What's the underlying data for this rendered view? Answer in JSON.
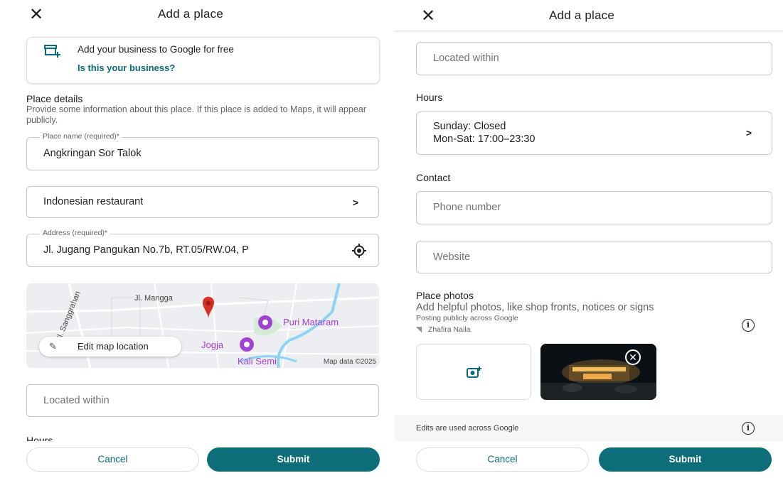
{
  "left": {
    "header": {
      "title": "Add a place",
      "close_icon": "close-icon"
    },
    "business_card": {
      "icon": "storefront-add-icon",
      "text": "Add your business to Google for free",
      "link": "Is this your business?"
    },
    "place_details": {
      "heading": "Place details",
      "description": "Provide some information about this place. If this place is added to Maps, it will appear publicly."
    },
    "place_name": {
      "label": "Place name (required)*",
      "value": "Angkringan Sor Talok"
    },
    "category": {
      "value": "Indonesian restaurant"
    },
    "address": {
      "label": "Address (required)*",
      "value": "Jl. Jugang Pangukan No.7b, RT.05/RW.04, P"
    },
    "map": {
      "street_1": "Jl. Mangga",
      "street_2": "Jl. Sanggrahan",
      "poi_1": "Puri Mataram",
      "poi_2": "Jogja",
      "poi_3": "Kali Semi",
      "credit": "Map data ©2025",
      "edit_button": "Edit map location"
    },
    "located_within": {
      "placeholder": "Located within"
    },
    "hours_heading": "Hours",
    "cancel": "Cancel",
    "submit": "Submit"
  },
  "right": {
    "header": {
      "title": "Add a place"
    },
    "located_within": {
      "placeholder": "Located within"
    },
    "hours": {
      "heading": "Hours",
      "line1": "Sunday: Closed",
      "line2": "Mon-Sat: 17:00–23:30"
    },
    "contact": {
      "heading": "Contact",
      "phone_placeholder": "Phone number",
      "website_placeholder": "Website"
    },
    "photos": {
      "heading": "Place photos",
      "subtitle": "Add helpful photos, like shop fronts, notices or signs",
      "posting": "Posting publicly across Google",
      "user": "Zhafira Naila"
    },
    "edits_note": "Edits are used across Google",
    "cancel": "Cancel",
    "submit": "Submit"
  },
  "colors": {
    "accent": "#0d6e7a",
    "link": "#0b6a78",
    "poi": "#a142d4",
    "pin": "#d93025"
  }
}
